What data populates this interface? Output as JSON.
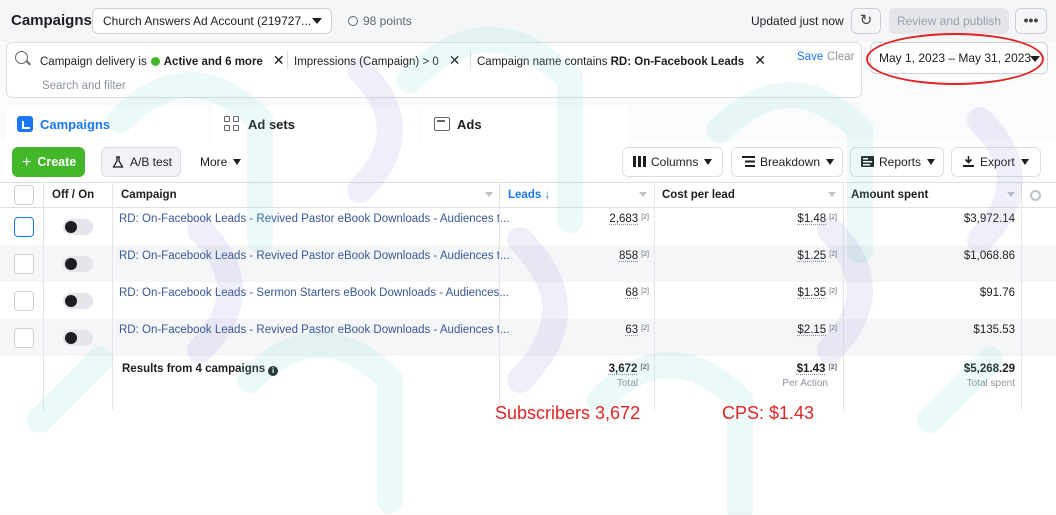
{
  "header": {
    "title": "Campaigns",
    "account": "Church Answers Ad Account (219727...",
    "points": "98 points",
    "updated": "Updated just now",
    "review_label": "Review and publish",
    "more_label": "•••"
  },
  "filters": {
    "chip1_prefix": "Campaign delivery is",
    "chip1_value": "Active and 6 more",
    "chip2_prefix": "Impressions (Campaign) > 0",
    "chip3_prefix": "Campaign name contains",
    "chip3_value": "RD: On-Facebook Leads",
    "save_label": "Save",
    "clear_label": "Clear",
    "search_placeholder": "Search and filter",
    "date_range": "May 1, 2023 – May 31, 2023"
  },
  "tabs": [
    {
      "label": "Campaigns"
    },
    {
      "label": "Ad sets"
    },
    {
      "label": "Ads"
    }
  ],
  "toolbar": {
    "create_label": "Create",
    "ab_label": "A/B test",
    "more_label": "More",
    "columns_label": "Columns",
    "breakdown_label": "Breakdown",
    "reports_label": "Reports",
    "export_label": "Export"
  },
  "table": {
    "headers": {
      "toggle": "Off / On",
      "campaign": "Campaign",
      "leads": "Leads ↓",
      "cost": "Cost per lead",
      "amount": "Amount spent"
    },
    "rows": [
      {
        "name": "RD: On-Facebook Leads - Revived Pastor eBook Downloads - Audiences t...",
        "leads": "2,683",
        "cost": "$1.48",
        "amount": "$3,972.14"
      },
      {
        "name": "RD: On-Facebook Leads - Revived Pastor eBook Downloads - Audiences t...",
        "leads": "858",
        "cost": "$1.25",
        "amount": "$1,068.86"
      },
      {
        "name": "RD: On-Facebook Leads - Sermon Starters eBook Downloads - Audiences...",
        "leads": "68",
        "cost": "$1.35",
        "amount": "$91.76"
      },
      {
        "name": "RD: On-Facebook Leads - Revived Pastor eBook Downloads - Audiences t...",
        "leads": "63",
        "cost": "$2.15",
        "amount": "$135.53"
      }
    ],
    "footnote_mark": "[2]",
    "summary": {
      "label": "Results from 4 campaigns",
      "leads": "3,672",
      "leads_sub": "Total",
      "cost": "$1.43",
      "cost_sub": "Per Action",
      "amount": "$5,268.29",
      "amount_sub": "Total spent"
    }
  },
  "annotations": {
    "subscribers": "Subscribers 3,672",
    "cps": "CPS:  $1.43"
  },
  "colors": {
    "accent": "#1877f2",
    "create_green": "#42b72a",
    "annotation_red": "#e02424",
    "link_blue": "#385898"
  }
}
